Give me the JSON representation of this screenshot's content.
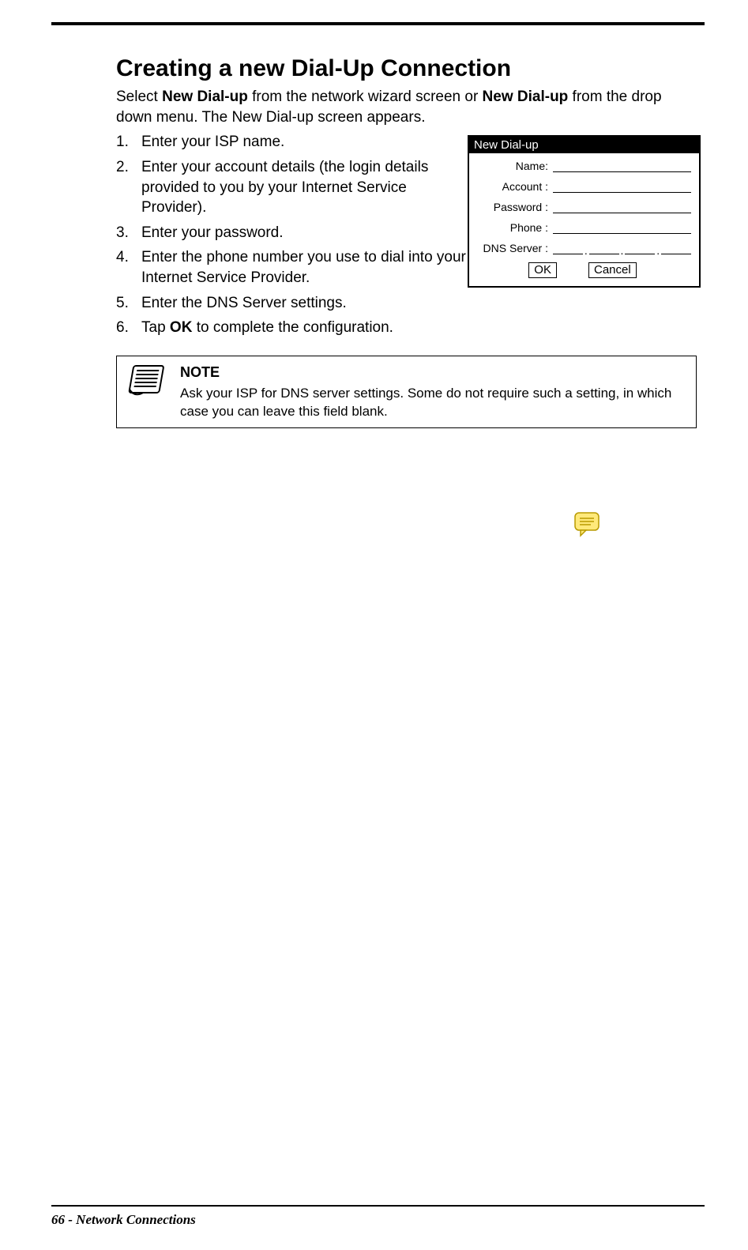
{
  "heading": "Creating a new Dial-Up Connection",
  "intro_pre": "Select ",
  "intro_bold1": "New Dial-up",
  "intro_mid": " from the network wizard screen or ",
  "intro_bold2": "New Dial-up",
  "intro_post": " from the drop down menu. The New Dial-up screen appears.",
  "steps": [
    {
      "n": "1.",
      "text": "Enter your ISP name."
    },
    {
      "n": "2.",
      "text": "Enter your account details (the login details provided to you by your Internet Service Provider)."
    },
    {
      "n": "3.",
      "text": "Enter your password."
    },
    {
      "n": "4.",
      "text": "Enter the phone number you use to dial into your Internet Service Provider."
    },
    {
      "n": "5.",
      "text": "Enter the DNS Server settings."
    }
  ],
  "step6": {
    "n": "6.",
    "pre": "Tap ",
    "bold": "OK",
    "post": " to complete the configuration."
  },
  "dialog": {
    "title": "New Dial-up",
    "labels": {
      "name": "Name:",
      "account": "Account :",
      "password": "Password :",
      "phone": "Phone :",
      "dns": "DNS Server :"
    },
    "ok": "OK",
    "cancel": "Cancel",
    "dot": "."
  },
  "note": {
    "title": "NOTE",
    "text": "Ask your ISP for DNS server settings. Some do not require such a setting, in which case you can leave this field blank."
  },
  "footer": {
    "page": "66",
    "sep": "  -  ",
    "section": "Network Connections"
  }
}
